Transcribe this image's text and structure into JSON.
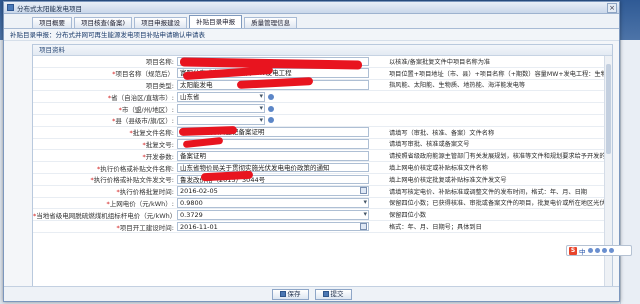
{
  "window": {
    "title": "分布式太阳能发电项目",
    "close_glyph": "×"
  },
  "tabs": [
    {
      "label": "项目概要",
      "active": false
    },
    {
      "label": "项目核查(备案)",
      "active": false
    },
    {
      "label": "项目申报建设",
      "active": false
    },
    {
      "label": "补贴目录申报",
      "active": true
    },
    {
      "label": "质量管理信息",
      "active": false
    }
  ],
  "breadcrumb": "补贴目录申报：分布式并网可再生能源发电项目补贴申请确认申请表",
  "section_title": "项目资料",
  "rows": [
    {
      "label": "项目名称:",
      "required": false,
      "value": "",
      "note": "以核准/备案批复文件中项目名称为准",
      "type": "text"
    },
    {
      "label": "项目名称（规范后）",
      "required": true,
      "value": "富阳分布式光伏发电项目   MW发电工程",
      "note": "项目位置+项目地址（市、县）+项目名称（+期数）容量MW+发电工程：生物质项目需说明燃料类型及技术类型",
      "type": "text"
    },
    {
      "label": "项目类型:",
      "required": false,
      "value": "太阳能发电",
      "note": "指风能、太阳能、生物质、地热能、海洋能发电等",
      "type": "text"
    },
    {
      "label": "省（自治区/直辖市）:",
      "required": true,
      "value": "山东省",
      "note": "",
      "type": "select"
    },
    {
      "label": "市（盟/州/地区）:",
      "required": true,
      "value": "",
      "note": "",
      "type": "select"
    },
    {
      "label": "县（县级市/旗/区）:",
      "required": true,
      "value": "",
      "note": "",
      "type": "select"
    },
    {
      "label": "批复文件名称:",
      "required": true,
      "value": "山东省建设项目登记备案证明",
      "note": "请填写（审批、核准、备案）文件名称",
      "type": "text"
    },
    {
      "label": "批复文号:",
      "required": true,
      "value": "",
      "note": "请填写审批、核准或备案文号",
      "type": "text"
    },
    {
      "label": "开发参数:",
      "required": true,
      "value": "备案证明",
      "note": "请按照省级政府能源主管部门有关发展规划，核准等文件和规划要求给予开发的说明",
      "type": "text"
    },
    {
      "label": "执行价格或补贴文件名称:",
      "required": true,
      "value": "山东省物价局关于贯彻实施光伏发电电价政策的通知",
      "note": "填上网电价核定或补贴标准文件名称",
      "type": "text"
    },
    {
      "label": "执行价格或补贴文件发文号:",
      "required": true,
      "value": "鲁发改价格（2015）3044号",
      "note": "填上网电价核定批复或补贴标准文件发文号",
      "type": "text"
    },
    {
      "label": "执行价格批复时间:",
      "required": true,
      "value": "2016-02-05",
      "note": "请填写核定电价、补贴标准或调整文件的发布时间，格式：年、月、日期",
      "type": "date"
    },
    {
      "label": "上网电价（元/kWh）:",
      "required": true,
      "value": "0.9800",
      "note": "保留四位小数；已获得核准、审批或备案文件的项目，批复电价或所在地区光伏电站标杆上网电价，如 电价...",
      "type": "spin"
    },
    {
      "label": "当地省级电网脱硫燃煤机组标杆电价（元/kWh）:",
      "required": true,
      "value": "0.3729",
      "note": "保留四位小数",
      "type": "spin"
    },
    {
      "label": "项目开工建设时间:",
      "required": true,
      "value": "2016-11-01",
      "note": "格式：年、月、日期号；具体到日",
      "type": "date"
    }
  ],
  "buttons": [
    {
      "label": "保存"
    },
    {
      "label": "提交"
    }
  ],
  "ime": {
    "s": "S",
    "label": "中"
  }
}
